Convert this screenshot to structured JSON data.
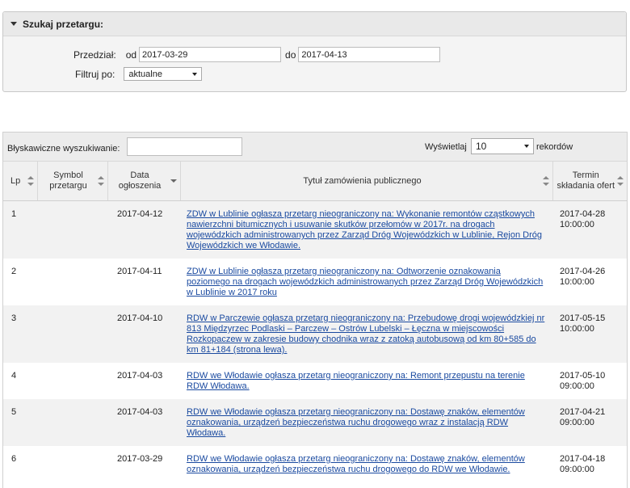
{
  "search": {
    "title": "Szukaj przetargu:",
    "range_label": "Przedział:",
    "from_label": "od",
    "from_value": "2017-03-29",
    "to_label": "do",
    "to_value": "2017-04-13",
    "filter_label": "Filtruj po:",
    "filter_value": "aktualne"
  },
  "toolbar": {
    "quick_search_label": "Błyskawiczne wyszukiwanie:",
    "quick_search_value": "",
    "show_label": "Wyświetlaj",
    "show_value": "10",
    "records_label": "rekordów"
  },
  "table": {
    "columns": [
      "Lp",
      "Symbol przetargu",
      "Data ogłoszenia",
      "Tytuł zamówienia publicznego",
      "Termin składania ofert"
    ],
    "rows": [
      {
        "lp": "1",
        "symbol": "",
        "date": "2017-04-12",
        "title": "ZDW w Lublinie ogłasza przetarg nieograniczony na: Wykonanie remontów cząstkowych nawierzchni bitumicznych i usuwanie skutków przełomów w 2017r. na drogach wojewódzkich administrowanych przez Zarząd Dróg Wojewódzkich w Lublinie, Rejon Dróg Wojewódzkich we Włodawie.",
        "deadline_date": "2017-04-28",
        "deadline_time": "10:00:00"
      },
      {
        "lp": "2",
        "symbol": "",
        "date": "2017-04-11",
        "title": "ZDW w Lublinie ogłasza przetarg nieograniczony na: Odtworzenie oznakowania poziomego na drogach wojewódzkich administrowanych przez Zarząd Dróg Wojewódzkich w Lublinie w 2017 roku",
        "deadline_date": "2017-04-26",
        "deadline_time": "10:00:00"
      },
      {
        "lp": "3",
        "symbol": "",
        "date": "2017-04-10",
        "title": "RDW w Parczewie ogłasza przetarg nieograniczony na: Przebudowę drogi wojewódzkiej nr 813 Międzyrzec Podlaski – Parczew – Ostrów Lubelski – Łęczna w miejscowości Rozkopaczew w zakresie budowy chodnika wraz z zatoką autobusową od km 80+585 do km 81+184 (strona lewa).",
        "deadline_date": "2017-05-15",
        "deadline_time": "10:00:00"
      },
      {
        "lp": "4",
        "symbol": "",
        "date": "2017-04-03",
        "title": "RDW we Włodawie ogłasza przetarg nieograniczony na: Remont przepustu na terenie RDW Włodawa.",
        "deadline_date": "2017-05-10",
        "deadline_time": "09:00:00"
      },
      {
        "lp": "5",
        "symbol": "",
        "date": "2017-04-03",
        "title": "RDW we Włodawie ogłasza przetarg nieograniczony na: Dostawę znaków, elementów oznakowania, urządzeń bezpieczeństwa ruchu drogowego wraz z instalacją RDW Włodawa.",
        "deadline_date": "2017-04-21",
        "deadline_time": "09:00:00"
      },
      {
        "lp": "6",
        "symbol": "",
        "date": "2017-03-29",
        "title": "RDW we Włodawie ogłasza przetarg nieograniczony na: Dostawę znaków, elementów oznakowania, urządzeń bezpieczeństwa ruchu drogowego do RDW we Włodawie.",
        "deadline_date": "2017-04-18",
        "deadline_time": "09:00:00"
      }
    ]
  }
}
